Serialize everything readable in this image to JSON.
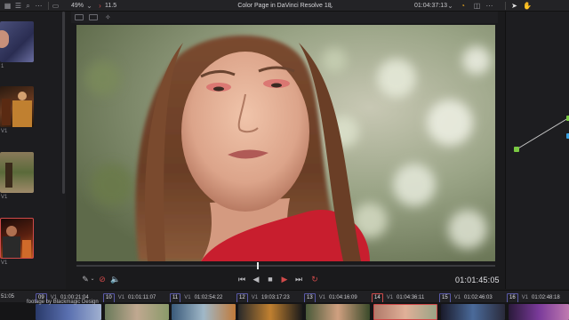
{
  "header": {
    "zoom": "49%",
    "frame": "11.5",
    "title": "Color Page in DaVinci Resolve 18",
    "timecode": "01:04:37:13"
  },
  "gallery": {
    "labels": [
      "1",
      "V1",
      "V1",
      "V1"
    ]
  },
  "transport": {
    "timecode": "01:01:45:05",
    "playhead_fraction": 0.43
  },
  "timeline": {
    "leading_tc": "51:05",
    "clips": [
      {
        "num": "09",
        "track": "V1",
        "tc": "01:00:21:04"
      },
      {
        "num": "10",
        "track": "V1",
        "tc": "01:01:11:07"
      },
      {
        "num": "11",
        "track": "V1",
        "tc": "01:02:54:22"
      },
      {
        "num": "12",
        "track": "V1",
        "tc": "19:03:17:23"
      },
      {
        "num": "13",
        "track": "V1",
        "tc": "01:04:16:09"
      },
      {
        "num": "14",
        "track": "V1",
        "tc": "01:04:36:11"
      },
      {
        "num": "15",
        "track": "V1",
        "tc": "01:02:46:03"
      },
      {
        "num": "16",
        "track": "V1",
        "tc": "01:02:48:18"
      }
    ],
    "credit": "footage by Blackmagic Design"
  },
  "colors": {
    "accent_red": "#d04a4a",
    "clip_border": "#5a5aa8",
    "node_green": "#7ac943",
    "node_blue": "#3aa0e0"
  }
}
